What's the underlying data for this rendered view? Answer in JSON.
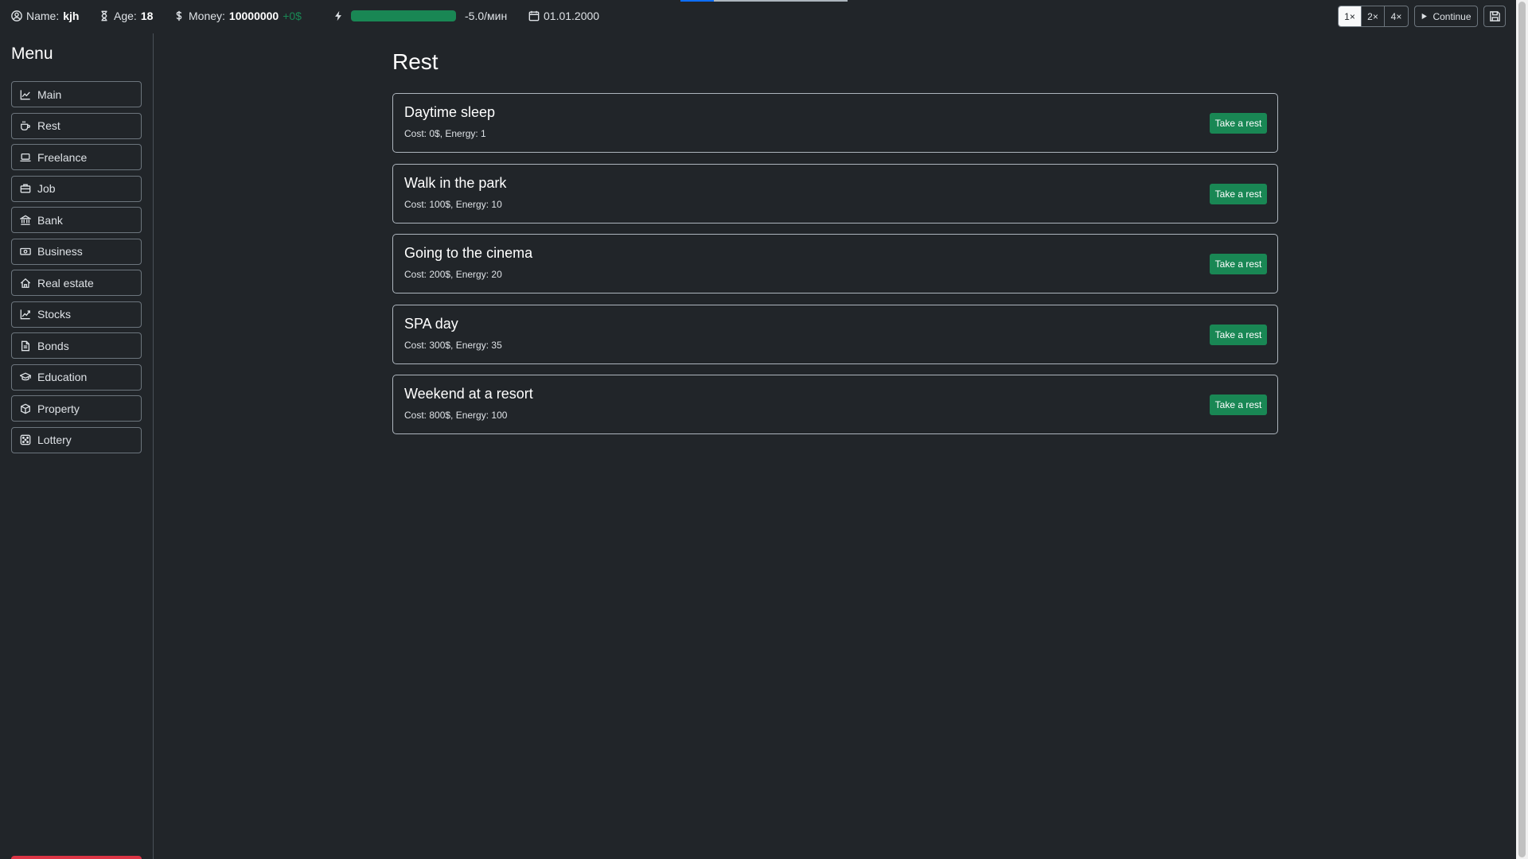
{
  "header": {
    "name_label": "Name:",
    "name_value": "kjh",
    "age_label": "Age:",
    "age_value": "18",
    "money_label": "Money:",
    "money_value": "10000000",
    "money_delta": "+0$",
    "energy_level": 1.0,
    "energy_rate": "-5.0/мин",
    "date": "01.01.2000",
    "speed_options": [
      "1×",
      "2×",
      "4×"
    ],
    "speed_selected": "1×",
    "continue_label": "Continue",
    "icons": {
      "name": "user-circle-icon",
      "age": "hourglass-icon",
      "money": "dollar-icon",
      "energy": "lightning-icon",
      "date": "calendar-icon",
      "continue": "play-icon",
      "save": "save-icon"
    },
    "colors": {
      "energy": "#198754",
      "delta": "#198754"
    }
  },
  "sidebar": {
    "title": "Menu",
    "items": [
      {
        "label": "Main",
        "icon": "chart-line-icon"
      },
      {
        "label": "Rest",
        "icon": "cup-icon"
      },
      {
        "label": "Freelance",
        "icon": "laptop-icon"
      },
      {
        "label": "Job",
        "icon": "briefcase-icon"
      },
      {
        "label": "Bank",
        "icon": "bank-icon"
      },
      {
        "label": "Business",
        "icon": "cash-icon"
      },
      {
        "label": "Real estate",
        "icon": "house-icon"
      },
      {
        "label": "Stocks",
        "icon": "graph-up-icon"
      },
      {
        "label": "Bonds",
        "icon": "document-icon"
      },
      {
        "label": "Education",
        "icon": "mortarboard-icon"
      },
      {
        "label": "Property",
        "icon": "box-icon"
      },
      {
        "label": "Lottery",
        "icon": "dice-icon"
      }
    ]
  },
  "main": {
    "title": "Rest",
    "activities": [
      {
        "title": "Daytime sleep",
        "details": "Cost: 0$, Energy: 1",
        "button": "Take a rest"
      },
      {
        "title": "Walk in the park",
        "details": "Cost: 100$, Energy: 10",
        "button": "Take a rest"
      },
      {
        "title": "Going to the cinema",
        "details": "Cost: 200$, Energy: 20",
        "button": "Take a rest"
      },
      {
        "title": "SPA day",
        "details": "Cost: 300$, Energy: 35",
        "button": "Take a rest"
      },
      {
        "title": "Weekend at a resort",
        "details": "Cost: 800$, Energy: 100",
        "button": "Take a rest"
      }
    ],
    "colors": {
      "action": "#198754"
    }
  }
}
